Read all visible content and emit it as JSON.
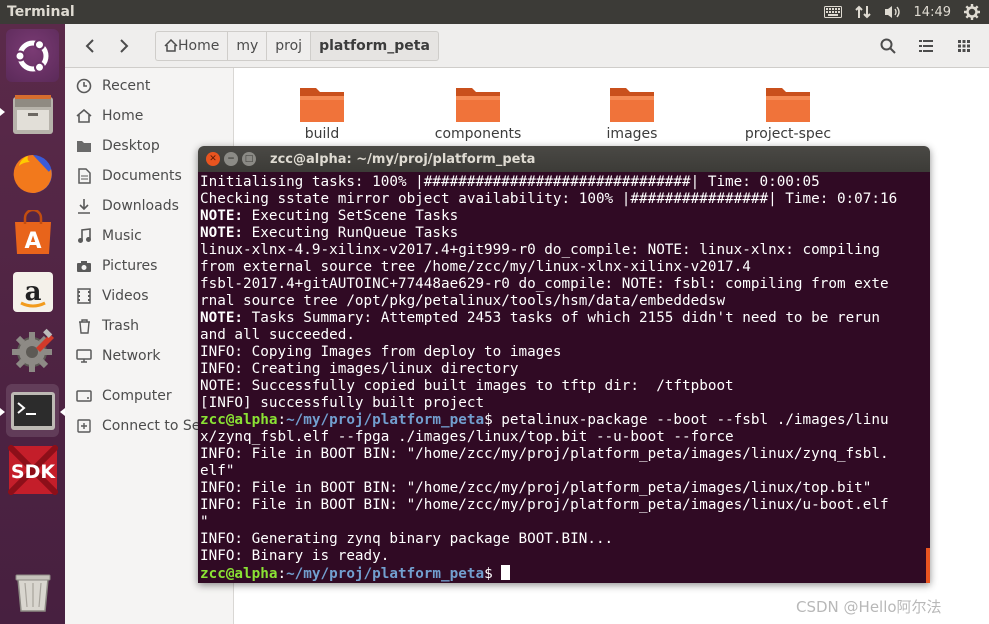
{
  "top_panel": {
    "title": "Terminal",
    "time": "14:49",
    "icons": [
      "keyboard-icon",
      "network-updown-icon",
      "volume-icon",
      "gear-icon"
    ]
  },
  "launcher": {
    "items": [
      "ubuntu-dash-icon",
      "files-icon",
      "firefox-icon",
      "software-center-icon",
      "amazon-icon",
      "system-settings-icon",
      "terminal-icon",
      "sdk-icon",
      "trash-icon"
    ],
    "sdk_label": "SDK",
    "amazon_label": "a"
  },
  "file_manager": {
    "breadcrumbs": [
      "Home",
      "my",
      "proj",
      "platform_peta"
    ],
    "sidebar": [
      {
        "label": "Recent",
        "icon": "clock-icon"
      },
      {
        "label": "Home",
        "icon": "home-icon"
      },
      {
        "label": "Desktop",
        "icon": "folder-icon"
      },
      {
        "label": "Documents",
        "icon": "document-icon"
      },
      {
        "label": "Downloads",
        "icon": "download-icon"
      },
      {
        "label": "Music",
        "icon": "music-icon"
      },
      {
        "label": "Pictures",
        "icon": "camera-icon"
      },
      {
        "label": "Videos",
        "icon": "video-icon"
      },
      {
        "label": "Trash",
        "icon": "trash-icon"
      },
      {
        "label": "Network",
        "icon": "network-icon"
      },
      {
        "label": "Computer",
        "icon": "drive-icon"
      },
      {
        "label": "Connect to Server",
        "icon": "plus-icon"
      }
    ],
    "folders": [
      "build",
      "components",
      "images",
      "project-spec"
    ]
  },
  "terminal": {
    "title": "zcc@alpha: ~/my/proj/platform_peta",
    "lines": [
      {
        "text": "Initialising tasks: 100% |###############################| Time: 0:00:05"
      },
      {
        "text": "Checking sstate mirror object availability: 100% |################| Time: 0:07:16"
      },
      {
        "bold": "NOTE:",
        "text": " Executing SetScene Tasks"
      },
      {
        "bold": "NOTE:",
        "text": " Executing RunQueue Tasks"
      },
      {
        "text": "linux-xlnx-4.9-xilinx-v2017.4+git999-r0 do_compile: NOTE: linux-xlnx: compiling"
      },
      {
        "text": "from external source tree /home/zcc/my/linux-xlnx-xilinx-v2017.4"
      },
      {
        "text": "fsbl-2017.4+gitAUTOINC+77448ae629-r0 do_compile: NOTE: fsbl: compiling from exte"
      },
      {
        "text": "rnal source tree /opt/pkg/petalinux/tools/hsm/data/embeddedsw"
      },
      {
        "bold": "NOTE:",
        "text": " Tasks Summary: Attempted 2453 tasks of which 2155 didn't need to be rerun"
      },
      {
        "text": "and all succeeded."
      },
      {
        "text": "INFO: Copying Images from deploy to images"
      },
      {
        "text": "INFO: Creating images/linux directory"
      },
      {
        "text": "NOTE: Successfully copied built images to tftp dir:  /tftpboot"
      },
      {
        "text": "[INFO] successfully built project"
      },
      {
        "user": "zcc@alpha",
        "sep": ":",
        "path": "~/my/proj/platform_peta",
        "text": "$ petalinux-package --boot --fsbl ./images/linu"
      },
      {
        "text": "x/zynq_fsbl.elf --fpga ./images/linux/top.bit --u-boot --force"
      },
      {
        "text": "INFO: File in BOOT BIN: \"/home/zcc/my/proj/platform_peta/images/linux/zynq_fsbl."
      },
      {
        "text": "elf\""
      },
      {
        "text": "INFO: File in BOOT BIN: \"/home/zcc/my/proj/platform_peta/images/linux/top.bit\""
      },
      {
        "text": "INFO: File in BOOT BIN: \"/home/zcc/my/proj/platform_peta/images/linux/u-boot.elf"
      },
      {
        "text": "\""
      },
      {
        "text": "INFO: Generating zynq binary package BOOT.BIN..."
      },
      {
        "text": "INFO: Binary is ready."
      },
      {
        "user": "zcc@alpha",
        "sep": ":",
        "path": "~/my/proj/platform_peta",
        "text": "$ ",
        "cursor": true
      }
    ]
  },
  "watermark": "CSDN @Hello阿尔法"
}
